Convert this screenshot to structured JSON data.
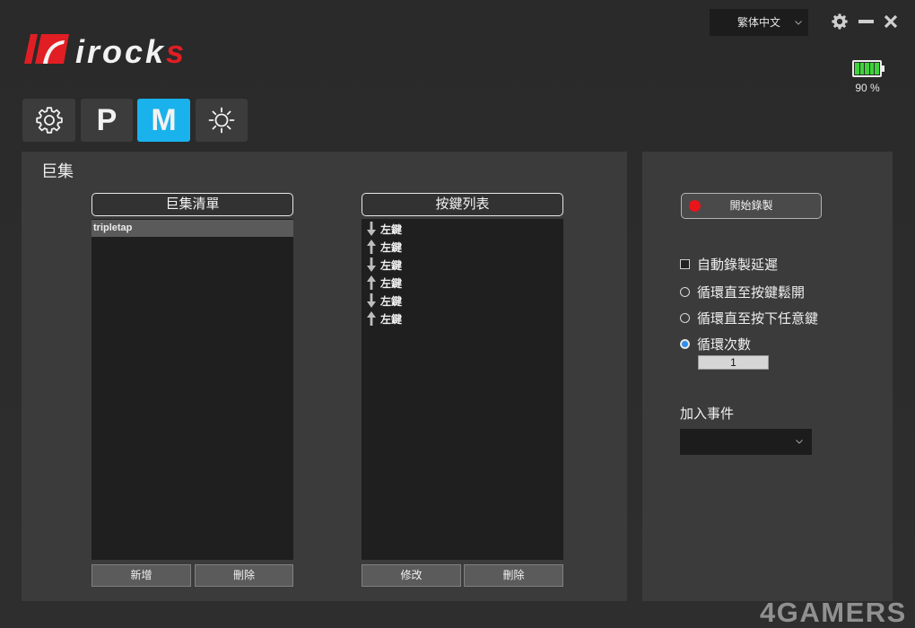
{
  "window": {
    "language": "繁体中文",
    "battery_percent": 90,
    "battery_label": "90 %"
  },
  "logo": {
    "text_main": "irock",
    "text_accent": "s"
  },
  "tabs": [
    {
      "icon": "gear-icon",
      "active": false
    },
    {
      "label": "P",
      "active": false
    },
    {
      "label": "M",
      "active": true
    },
    {
      "icon": "sun-icon",
      "active": false
    }
  ],
  "macro": {
    "section_title": "巨集",
    "macro_list": {
      "header": "巨集清單",
      "items": [
        {
          "name": "tripletap",
          "selected": true
        }
      ],
      "add_label": "新增",
      "delete_label": "刪除"
    },
    "key_list": {
      "header": "按鍵列表",
      "items": [
        {
          "direction": "down",
          "label": "左鍵"
        },
        {
          "direction": "up",
          "label": "左鍵"
        },
        {
          "direction": "down",
          "label": "左鍵"
        },
        {
          "direction": "up",
          "label": "左鍵"
        },
        {
          "direction": "down",
          "label": "左鍵"
        },
        {
          "direction": "up",
          "label": "左鍵"
        }
      ],
      "edit_label": "修改",
      "delete_label": "刪除"
    }
  },
  "recording": {
    "record_label": "開始錄製",
    "auto_delay": {
      "label": "自動錄製延遲",
      "checked": false
    },
    "loop_options": [
      {
        "label": "循環直至按鍵鬆開",
        "selected": false
      },
      {
        "label": "循環直至按下任意鍵",
        "selected": false
      },
      {
        "label": "循環次數",
        "selected": true
      }
    ],
    "loop_count": "1",
    "add_event_label": "加入事件"
  },
  "colors": {
    "accent": "#19b2ec",
    "record": "#e8151b",
    "battery": "#3fd23b",
    "logo_red": "#e01e24"
  },
  "watermark": "4GAMERS"
}
